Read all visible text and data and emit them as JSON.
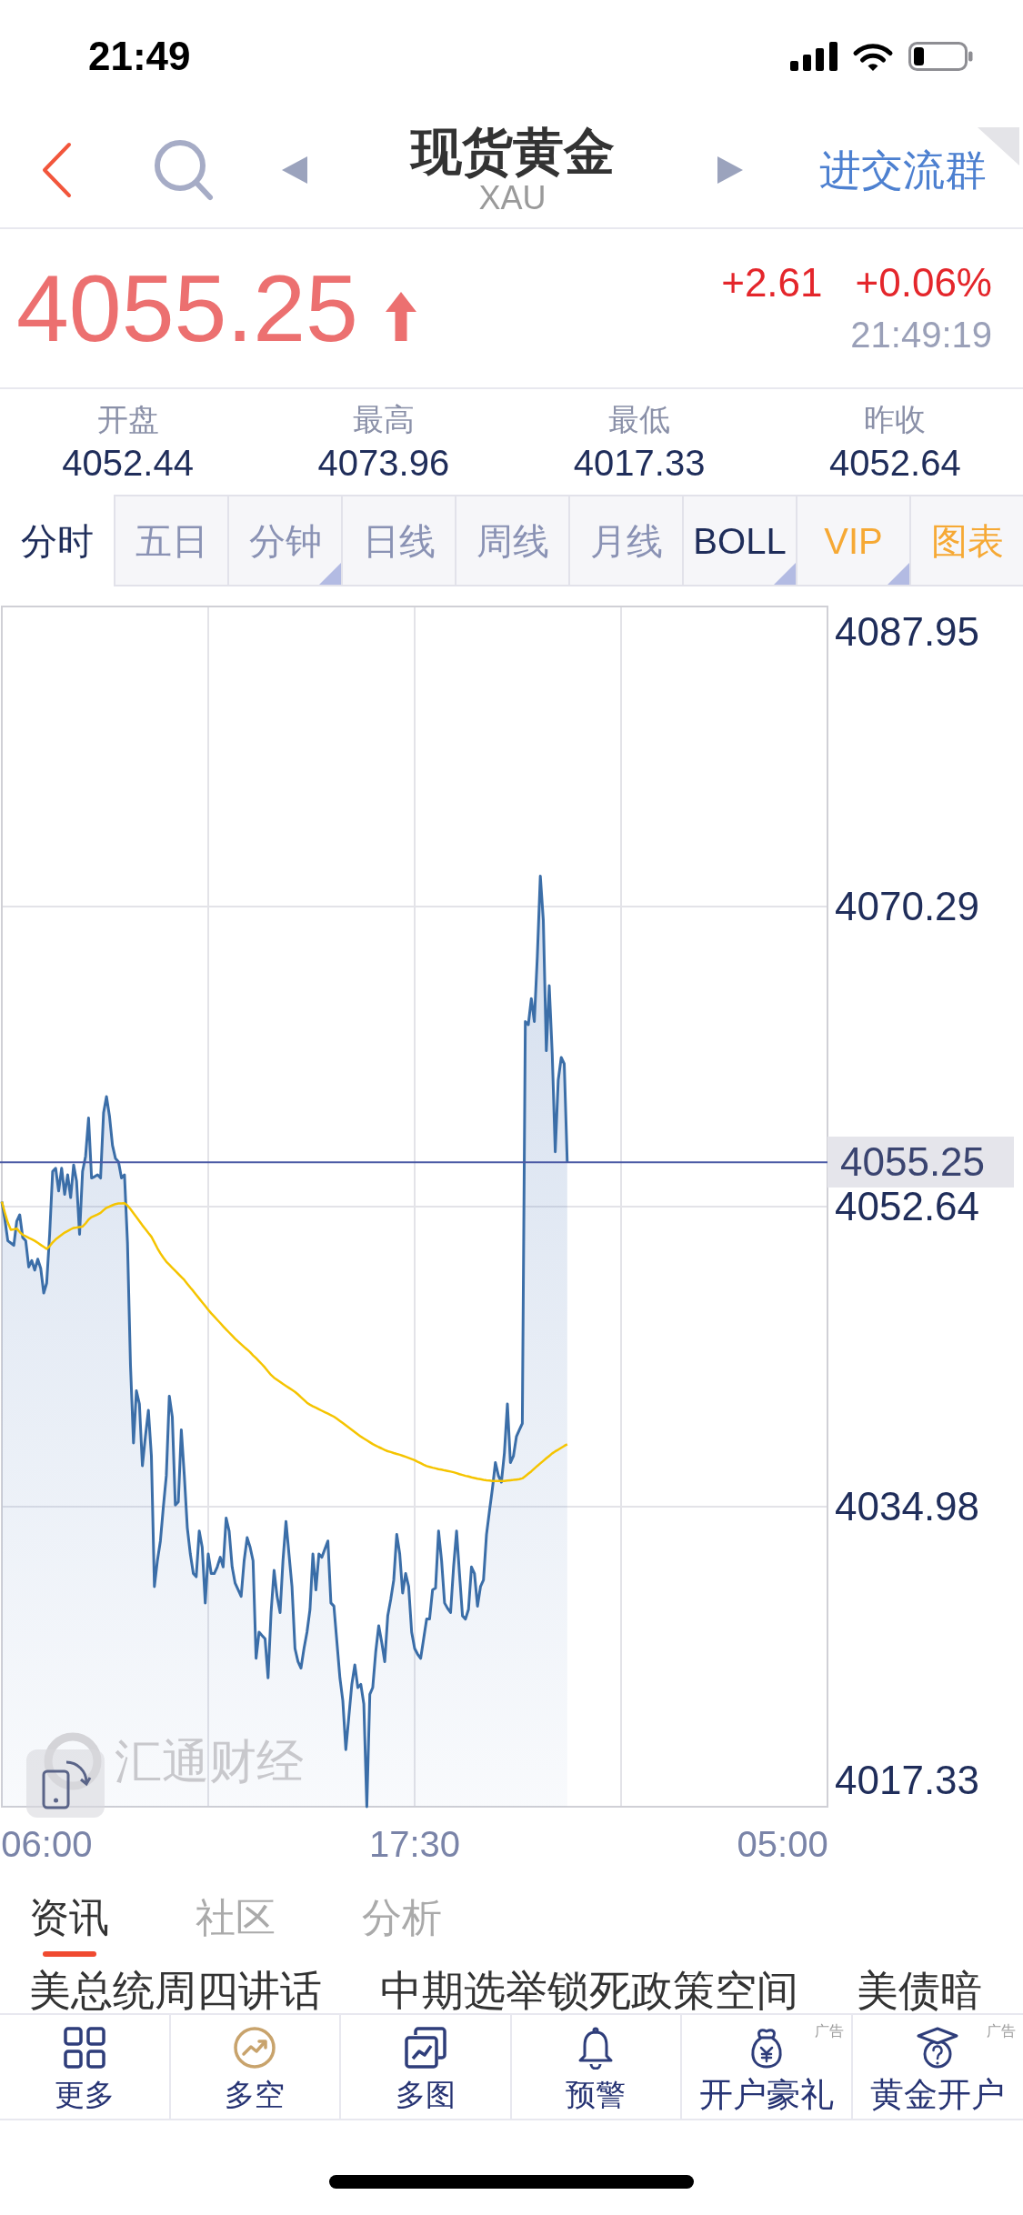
{
  "status_bar": {
    "time": "21:49"
  },
  "header": {
    "title": "现货黄金",
    "subtitle": "XAU",
    "action": "进交流群"
  },
  "quote": {
    "price": "4055.25",
    "up": true,
    "change": "+2.61",
    "change_percent": "+0.06%",
    "time": "21:49:19"
  },
  "stats": [
    {
      "label": "开盘",
      "value": "4052.44"
    },
    {
      "label": "最高",
      "value": "4073.96"
    },
    {
      "label": "最低",
      "value": "4017.33"
    },
    {
      "label": "昨收",
      "value": "4052.64"
    }
  ],
  "chart_tabs": [
    {
      "label": "分时",
      "kind": "period",
      "selected": true,
      "dropdown": false
    },
    {
      "label": "五日",
      "kind": "period",
      "selected": false,
      "dropdown": false
    },
    {
      "label": "分钟",
      "kind": "period",
      "selected": false,
      "dropdown": true
    },
    {
      "label": "日线",
      "kind": "period",
      "selected": false,
      "dropdown": false
    },
    {
      "label": "周线",
      "kind": "period",
      "selected": false,
      "dropdown": false
    },
    {
      "label": "月线",
      "kind": "period",
      "selected": false,
      "dropdown": false
    },
    {
      "label": "BOLL",
      "kind": "indicator",
      "selected": false,
      "dropdown": true
    },
    {
      "label": "VIP",
      "kind": "premium",
      "selected": false,
      "dropdown": true
    },
    {
      "label": "图表",
      "kind": "premium",
      "selected": false,
      "dropdown": false
    }
  ],
  "chart": {
    "watermark": "汇通财经",
    "chart_data": {
      "type": "line",
      "grid": true,
      "ylim": [
        4017.33,
        4087.95
      ],
      "yticks": [
        4087.95,
        4070.29,
        4052.64,
        4034.98,
        4017.33
      ],
      "ref_lines": [
        {
          "axis": "y",
          "value": 4055.25,
          "label": "4055.25"
        }
      ],
      "categories": [
        null,
        null,
        null,
        null,
        null,
        null,
        null,
        null,
        null,
        null,
        null,
        null,
        null,
        null,
        null,
        "06:00",
        null,
        null,
        null,
        null,
        null,
        null,
        null,
        null,
        null,
        null,
        null,
        null,
        null,
        null,
        null,
        null,
        null,
        null,
        null,
        null,
        null,
        null,
        null,
        null,
        null,
        null,
        null,
        null,
        null,
        null,
        null,
        null,
        null,
        null,
        null,
        null,
        null,
        null,
        null,
        null,
        null,
        null,
        null,
        null,
        null,
        null,
        null,
        null,
        null,
        null,
        null,
        null,
        null,
        null,
        null,
        null,
        null,
        null,
        null,
        null,
        null,
        null,
        null,
        null,
        null,
        null,
        null,
        null,
        null,
        null,
        null,
        null,
        null,
        null,
        null,
        null,
        null,
        null,
        null,
        null,
        null,
        null,
        null,
        null,
        null,
        null,
        null,
        null,
        null,
        null,
        null,
        null,
        null,
        null,
        null,
        null,
        null,
        null,
        null,
        null,
        null,
        null,
        null,
        null,
        null,
        null,
        null,
        null,
        null,
        null,
        null,
        null,
        null,
        null,
        null,
        null,
        null,
        null,
        null,
        null,
        null,
        null,
        "17:30",
        null,
        null,
        null,
        null,
        null,
        null,
        null,
        null,
        null,
        null,
        null,
        null,
        null,
        null,
        null,
        null,
        null,
        null,
        null,
        null,
        null,
        null,
        null,
        null,
        null,
        null,
        null,
        null,
        null,
        null,
        null,
        null,
        null,
        null,
        null,
        null,
        null,
        null,
        null,
        null,
        null,
        null,
        null,
        null,
        null,
        null,
        null,
        null,
        null,
        null,
        null,
        null,
        null,
        null,
        null,
        null,
        null,
        null,
        null,
        null,
        null,
        null,
        null,
        null,
        null,
        null,
        null,
        null,
        null,
        null,
        null,
        null,
        null,
        null,
        null,
        null,
        null,
        null,
        null,
        null,
        null,
        null,
        null,
        null,
        null,
        null,
        null,
        null,
        null,
        null,
        null,
        null,
        null,
        null,
        null,
        null,
        null,
        null,
        null,
        null,
        null,
        null,
        null,
        null,
        null,
        null,
        null,
        null,
        null,
        null,
        null,
        null,
        null,
        null,
        null,
        null,
        null,
        null,
        null,
        null,
        null,
        null,
        "05:00",
        null,
        null,
        null,
        null,
        null,
        null,
        null,
        null,
        null,
        null,
        null,
        null,
        null,
        null,
        null
      ],
      "series": [
        {
          "color": "#3b6ea8",
          "values": [
            4052.93,
            4051.9,
            4050.63,
            4050.5,
            4050.36,
            4051.78,
            4052.16,
            4050.82,
            4050.63,
            4049.09,
            4049.47,
            4048.9,
            4049.55,
            4049.0,
            4047.56,
            4048.13,
            4051.01,
            4054.71,
            4054.9,
            4053.56,
            4054.9,
            4053.36,
            4054.51,
            4053.17,
            4055.09,
            4054.13,
            4051.01,
            4054.71,
            4055.6,
            4057.85,
            4054.32,
            4054.4,
            4054.51,
            4054.32,
            4058.16,
            4059.12,
            4057.97,
            4056.24,
            4055.47,
            4055.28,
            4054.32,
            4054.51,
            4050.5,
            4043.3,
            4038.73,
            4041.8,
            4041.03,
            4037.39,
            4039.11,
            4040.65,
            4037.96,
            4030.28,
            4031.82,
            4032.97,
            4035.0,
            4036.81,
            4041.49,
            4040.26,
            4035.08,
            4035.27,
            4039.5,
            4036.81,
            4033.74,
            4032.2,
            4031.05,
            4030.86,
            4033.55,
            4032.59,
            4029.32,
            4032.2,
            4031.05,
            4031.05,
            4031.44,
            4032.01,
            4031.44,
            4034.31,
            4033.55,
            4031.44,
            4030.48,
            4030.1,
            4029.71,
            4031.82,
            4033.16,
            4032.59,
            4031.8,
            4026.06,
            4027.6,
            4027.4,
            4027.21,
            4024.91,
            4028.75,
            4031.24,
            4029.71,
            4028.75,
            4031.82,
            4034.12,
            4032.2,
            4030.28,
            4026.64,
            4025.87,
            4025.49,
            4026.64,
            4027.6,
            4028.94,
            4032.2,
            4030.09,
            4032.2,
            4032.01,
            4032.5,
            4032.97,
            4029.32,
            4029.13,
            4027.02,
            4024.91,
            4023.57,
            4020.69,
            4022.61,
            4024.53,
            4025.68,
            4024.34,
            4024.53,
            4023.38,
            4017.33,
            4023.95,
            4024.34,
            4026.45,
            4027.98,
            4027.0,
            4025.87,
            4028.56,
            4029.52,
            4030.67,
            4033.35,
            4032.2,
            4029.9,
            4031.05,
            4030.28,
            4027.6,
            4026.64,
            4026.3,
            4026.06,
            4027.21,
            4028.37,
            4028.37,
            4030.09,
            4030.2,
            4033.55,
            4031.82,
            4029.32,
            4029.0,
            4028.75,
            4031.44,
            4033.55,
            4031.05,
            4028.56,
            4028.37,
            4028.94,
            4031.44,
            4031.05,
            4029.13,
            4030.28,
            4030.67,
            4033.35,
            4034.7,
            4036.04,
            4037.58,
            4036.81,
            4036.43,
            4038.15,
            4041.03,
            4037.58,
            4037.96,
            4039.11,
            4039.5,
            4039.88,
            4063.53,
            4063.34,
            4064.88,
            4063.53,
            4067.37,
            4072.09,
            4069.48,
            4061.81,
            4065.64,
            4061.62,
            4055.86,
            4060.08,
            4061.42,
            4061.04,
            4055.25,
            null,
            null,
            null,
            null,
            null,
            null,
            null,
            null,
            null,
            null,
            null,
            null,
            null,
            null,
            null,
            null,
            null,
            null,
            null,
            null,
            null,
            null,
            null,
            null,
            null,
            null,
            null,
            null,
            null,
            null,
            null,
            null,
            null,
            null,
            null,
            null,
            null,
            null,
            null,
            null,
            null,
            null,
            null,
            null,
            null,
            null,
            null,
            null,
            null,
            null,
            null,
            null,
            null,
            null,
            null,
            null,
            null,
            null,
            null,
            null,
            null,
            null,
            null,
            null,
            null,
            null,
            null,
            null,
            null,
            null,
            null,
            null,
            null,
            null,
            null,
            null,
            null,
            null,
            null,
            null,
            null,
            null,
            null,
            null,
            null,
            null,
            null
          ]
        },
        {
          "color": "#f5c400",
          "values": [
            4052.93,
            4052.29,
            4051.7,
            4051.28,
            4051.3,
            4051.35,
            4051.14,
            4050.98,
            4050.89,
            4050.8,
            4050.72,
            4050.63,
            4050.51,
            4050.39,
            4050.27,
            4050.15,
            4050.31,
            4050.54,
            4050.71,
            4050.85,
            4050.98,
            4051.11,
            4051.2,
            4051.3,
            4051.39,
            4051.41,
            4051.44,
            4051.47,
            4051.65,
            4051.88,
            4052.02,
            4052.1,
            4052.18,
            4052.27,
            4052.43,
            4052.57,
            4052.64,
            4052.72,
            4052.79,
            4052.82,
            4052.83,
            4052.84,
            4052.71,
            4052.49,
            4052.25,
            4052.02,
            4051.78,
            4051.54,
            4051.32,
            4051.09,
            4050.87,
            4050.54,
            4050.19,
            4049.89,
            4049.63,
            4049.4,
            4049.22,
            4049.04,
            4048.86,
            4048.68,
            4048.5,
            4048.32,
            4048.1,
            4047.88,
            4047.67,
            4047.45,
            4047.23,
            4047.01,
            4046.79,
            4046.57,
            4046.36,
            4046.17,
            4045.98,
            4045.79,
            4045.6,
            4045.41,
            4045.23,
            4045.05,
            4044.86,
            4044.7,
            4044.54,
            4044.38,
            4044.23,
            4044.07,
            4043.89,
            4043.72,
            4043.54,
            4043.36,
            4043.16,
            4042.94,
            4042.73,
            4042.57,
            4042.45,
            4042.33,
            4042.21,
            4042.09,
            4041.97,
            4041.86,
            4041.74,
            4041.59,
            4041.42,
            4041.26,
            4041.1,
            4040.98,
            4040.89,
            4040.81,
            4040.72,
            4040.63,
            4040.54,
            4040.46,
            4040.37,
            4040.28,
            4040.16,
            4040.03,
            4039.9,
            4039.77,
            4039.64,
            4039.51,
            4039.37,
            4039.24,
            4039.11,
            4039.0,
            4038.89,
            4038.78,
            4038.67,
            4038.58,
            4038.49,
            4038.41,
            4038.32,
            4038.25,
            4038.2,
            4038.14,
            4038.09,
            4038.04,
            4037.98,
            4037.92,
            4037.86,
            4037.79,
            4037.72,
            4037.63,
            4037.54,
            4037.45,
            4037.37,
            4037.33,
            4037.28,
            4037.24,
            4037.19,
            4037.16,
            4037.12,
            4037.09,
            4037.05,
            4037.01,
            4036.96,
            4036.9,
            4036.85,
            4036.8,
            4036.76,
            4036.71,
            4036.67,
            4036.63,
            4036.6,
            4036.57,
            4036.54,
            4036.52,
            4036.5,
            4036.5,
            4036.5,
            4036.5,
            4036.5,
            4036.52,
            4036.54,
            4036.56,
            4036.58,
            4036.6,
            4036.65,
            4036.78,
            4036.92,
            4037.06,
            4037.22,
            4037.38,
            4037.53,
            4037.68,
            4037.83,
            4037.97,
            4038.12,
            4038.24,
            4038.34,
            4038.45,
            4038.56,
            4038.66,
            null,
            null,
            null,
            null,
            null,
            null,
            null,
            null,
            null,
            null,
            null,
            null,
            null,
            null,
            null,
            null,
            null,
            null,
            null,
            null,
            null,
            null,
            null,
            null,
            null,
            null,
            null,
            null,
            null,
            null,
            null,
            null,
            null,
            null,
            null,
            null,
            null,
            null,
            null,
            null,
            null,
            null,
            null,
            null,
            null,
            null,
            null,
            null,
            null,
            null,
            null,
            null,
            null,
            null,
            null,
            null,
            null,
            null,
            null,
            null,
            null,
            null,
            null,
            null,
            null,
            null,
            null,
            null,
            null,
            null,
            null,
            null,
            null,
            null,
            null,
            null,
            null,
            null,
            null,
            null,
            null,
            null,
            null,
            null,
            null,
            null,
            null
          ]
        }
      ]
    }
  },
  "news_tabs": [
    {
      "label": "资讯",
      "selected": true
    },
    {
      "label": "社区",
      "selected": false
    },
    {
      "label": "分析",
      "selected": false
    }
  ],
  "news": [
    "美总统周四讲话",
    "中期选举锁死政策空间",
    "美债暗"
  ],
  "bottom_nav": [
    {
      "label": "更多"
    },
    {
      "label": "多空"
    },
    {
      "label": "多图"
    },
    {
      "label": "预警"
    },
    {
      "label": "开户豪礼",
      "ad_tag": "广告"
    },
    {
      "label": "黄金开户",
      "ad_tag": "广告"
    }
  ]
}
